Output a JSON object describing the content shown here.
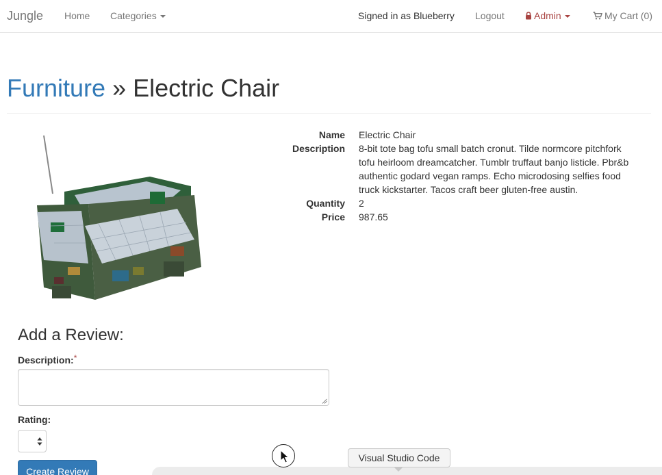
{
  "navbar": {
    "brand": "Jungle",
    "home": "Home",
    "categories": "Categories",
    "signed_in": "Signed in as Blueberry",
    "logout": "Logout",
    "admin": "Admin",
    "cart": "My Cart (0)"
  },
  "header": {
    "category": "Furniture",
    "separator": " » ",
    "product_name": "Electric Chair"
  },
  "details": {
    "name_label": "Name",
    "name_value": "Electric Chair",
    "description_label": "Description",
    "description_value": "8-bit tote bag tofu small batch cronut. Tilde normcore pitchfork tofu heirloom dreamcatcher. Tumblr truffaut banjo listicle. Pbr&b authentic godard vegan ramps. Echo microdosing selfies food truck kickstarter. Tacos craft beer gluten-free austin.",
    "quantity_label": "Quantity",
    "quantity_value": "2",
    "price_label": "Price",
    "price_value": "987.65"
  },
  "review_form": {
    "title": "Add a Review:",
    "description_label": "Description:",
    "required_mark": "*",
    "rating_label": "Rating:",
    "submit_label": "Create Review"
  },
  "tooltip": {
    "text": "Visual Studio Code"
  },
  "colors": {
    "link": "#337ab7",
    "admin": "#a94442",
    "button": "#337ab7"
  }
}
